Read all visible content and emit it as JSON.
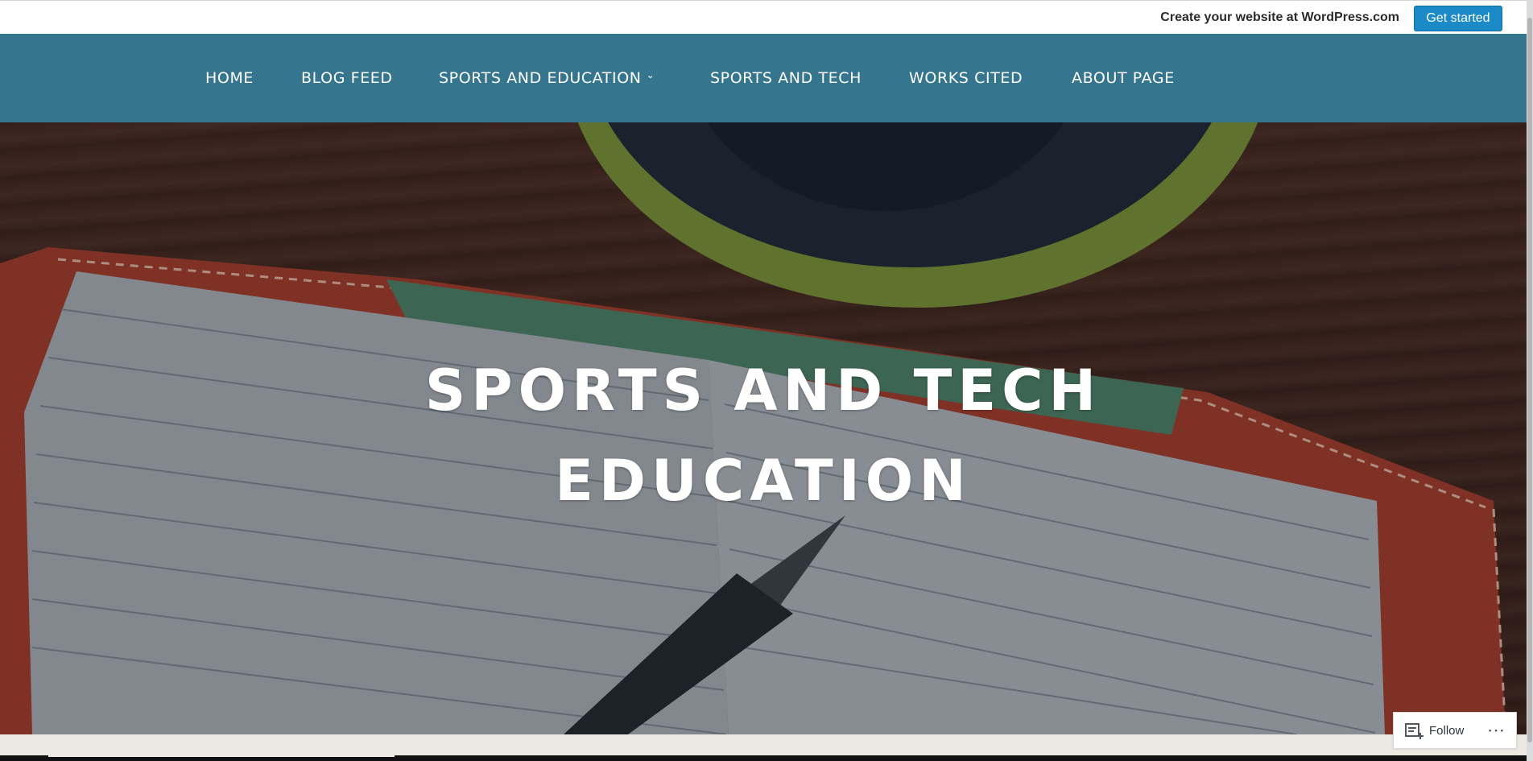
{
  "promo": {
    "text": "Create your website at WordPress.com",
    "button_label": "Get started"
  },
  "nav": {
    "items": [
      {
        "label": "HOME"
      },
      {
        "label": "BLOG FEED"
      },
      {
        "label": "SPORTS AND EDUCATION",
        "has_dropdown": true
      },
      {
        "label": "SPORTS AND TECH"
      },
      {
        "label": "WORKS CITED"
      },
      {
        "label": "ABOUT PAGE"
      }
    ],
    "dropdown_icon": "chevron-down-icon"
  },
  "hero": {
    "title_line1": "SPORTS AND TECH",
    "title_line2": "EDUCATION"
  },
  "follow": {
    "label": "Follow",
    "icon": "reader-follow-icon",
    "more_icon": "ellipsis-icon"
  },
  "colors": {
    "nav_bg": "#35758e",
    "button_bg": "#1c8ac7"
  }
}
